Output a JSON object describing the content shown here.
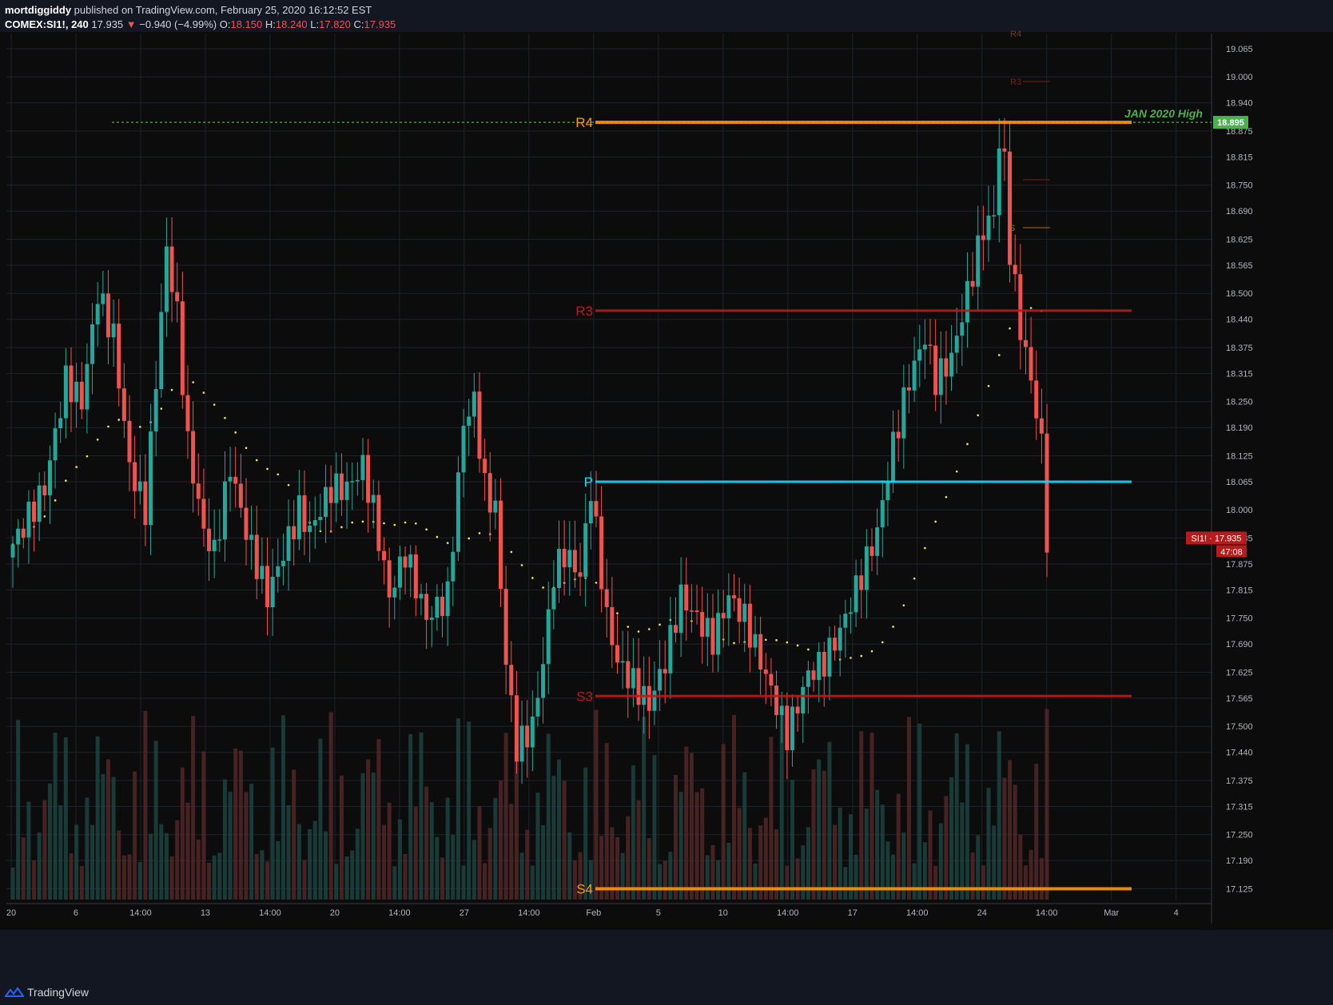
{
  "header": {
    "publisher": "mortdiggiddy",
    "published_text": "published on TradingView.com, February 25, 2020 16:12:52 EST",
    "symbol": "COMEX:SI1!, 240",
    "last": "17.935",
    "change_arrow": "▼",
    "change": "−0.940 (−4.99%)",
    "o_label": "O:",
    "o_value": "18.150",
    "h_label": "H:",
    "h_value": "18.240",
    "l_label": "L:",
    "l_value": "17.820",
    "c_label": "C:",
    "c_value": "17.935"
  },
  "footer": {
    "brand": "TradingView",
    "logo_icon": "tradingview-logo-icon"
  },
  "colors": {
    "background": "#131722",
    "grid": "#1e222d",
    "up": "#26a69a",
    "down": "#ef5350",
    "pivot_p": "#00e5ff",
    "r4_s4": "#ff9800",
    "r3_s3": "#b71c1c",
    "jan_high": "#4caf50",
    "sma": "#ffeb3b"
  },
  "chart_data": {
    "type": "candlestick",
    "timeframe": "240",
    "y_ticks": [
      "19.065",
      "19.000",
      "18.940",
      "18.875",
      "18.815",
      "18.750",
      "18.690",
      "18.625",
      "18.565",
      "18.500",
      "18.440",
      "18.375",
      "18.315",
      "18.250",
      "18.190",
      "18.125",
      "18.065",
      "18.000",
      "17.935",
      "17.875",
      "17.815",
      "17.750",
      "17.690",
      "17.625",
      "17.565",
      "17.500",
      "17.440",
      "17.375",
      "17.315",
      "17.250",
      "17.190",
      "17.125"
    ],
    "ylim": [
      17.1,
      19.1
    ],
    "x_ticks": [
      "20",
      "6",
      "14:00",
      "13",
      "14:00",
      "20",
      "14:00",
      "27",
      "14:00",
      "Feb",
      "5",
      "10",
      "14:00",
      "17",
      "14:00",
      "24",
      "14:00",
      "Mar",
      "4"
    ],
    "pivots": [
      {
        "label": "R4",
        "value": 18.895
      },
      {
        "label": "R3",
        "value": 18.46
      },
      {
        "label": "P",
        "value": 18.065
      },
      {
        "label": "S3",
        "value": 17.57
      },
      {
        "label": "S4",
        "value": 17.125
      }
    ],
    "small_pivot_labels": [
      "R4",
      "R3",
      "S"
    ],
    "annotation": {
      "text": "JAN 2020 High",
      "value": 18.895
    },
    "price_tags": [
      {
        "text": "18.895",
        "value": 18.895
      },
      {
        "text": "SI1! · 17.935",
        "value": 17.935
      },
      {
        "text": "47:08",
        "value": 17.9
      }
    ],
    "anchors": [
      [
        0,
        17.92
      ],
      [
        6,
        18.05
      ],
      [
        10,
        18.3
      ],
      [
        13,
        18.25
      ],
      [
        16,
        18.5
      ],
      [
        19,
        18.4
      ],
      [
        22,
        18.1
      ],
      [
        25,
        18.0
      ],
      [
        27,
        18.3
      ],
      [
        29,
        18.6
      ],
      [
        31,
        18.45
      ],
      [
        33,
        18.15
      ],
      [
        36,
        17.95
      ],
      [
        38,
        17.9
      ],
      [
        41,
        18.1
      ],
      [
        44,
        17.95
      ],
      [
        48,
        17.8
      ],
      [
        51,
        17.9
      ],
      [
        54,
        18.0
      ],
      [
        56,
        17.95
      ],
      [
        60,
        18.05
      ],
      [
        63,
        18.05
      ],
      [
        66,
        18.1
      ],
      [
        68,
        18.0
      ],
      [
        71,
        17.8
      ],
      [
        74,
        17.9
      ],
      [
        78,
        17.75
      ],
      [
        82,
        17.8
      ],
      [
        85,
        18.2
      ],
      [
        87,
        18.25
      ],
      [
        89,
        18.05
      ],
      [
        91,
        18.0
      ],
      [
        93,
        17.65
      ],
      [
        95,
        17.45
      ],
      [
        98,
        17.5
      ],
      [
        100,
        17.65
      ],
      [
        102,
        17.85
      ],
      [
        104,
        17.9
      ],
      [
        107,
        17.85
      ],
      [
        109,
        18.05
      ],
      [
        110,
        17.95
      ],
      [
        112,
        17.75
      ],
      [
        114,
        17.65
      ],
      [
        117,
        17.6
      ],
      [
        120,
        17.55
      ],
      [
        123,
        17.65
      ],
      [
        126,
        17.8
      ],
      [
        129,
        17.75
      ],
      [
        132,
        17.7
      ],
      [
        135,
        17.8
      ],
      [
        138,
        17.75
      ],
      [
        141,
        17.65
      ],
      [
        144,
        17.55
      ],
      [
        146,
        17.48
      ],
      [
        148,
        17.55
      ],
      [
        150,
        17.62
      ],
      [
        153,
        17.65
      ],
      [
        156,
        17.72
      ],
      [
        160,
        17.85
      ],
      [
        163,
        17.95
      ],
      [
        166,
        18.15
      ],
      [
        169,
        18.3
      ],
      [
        172,
        18.4
      ],
      [
        174,
        18.3
      ],
      [
        177,
        18.35
      ],
      [
        180,
        18.5
      ],
      [
        183,
        18.65
      ],
      [
        185,
        18.68
      ],
      [
        186,
        18.85
      ],
      [
        187,
        18.8
      ],
      [
        188,
        18.6
      ],
      [
        190,
        18.42
      ],
      [
        192,
        18.3
      ],
      [
        194,
        18.15
      ],
      [
        195,
        17.935
      ]
    ],
    "candle_count": 196
  }
}
